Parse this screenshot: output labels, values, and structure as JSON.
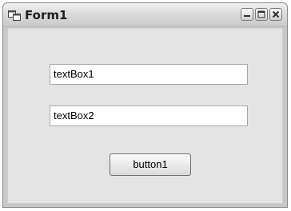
{
  "window": {
    "title": "Form1",
    "icons": {
      "app": "form-window-icon",
      "minimize": "minimize-icon",
      "maximize": "maximize-icon",
      "close": "close-icon"
    }
  },
  "form": {
    "textbox1": {
      "value": "textBox1"
    },
    "textbox2": {
      "value": "textBox2"
    },
    "button1": {
      "label": "button1"
    }
  },
  "colors": {
    "client_background": "#e4e4e4",
    "frame": "#c8c8c8"
  }
}
